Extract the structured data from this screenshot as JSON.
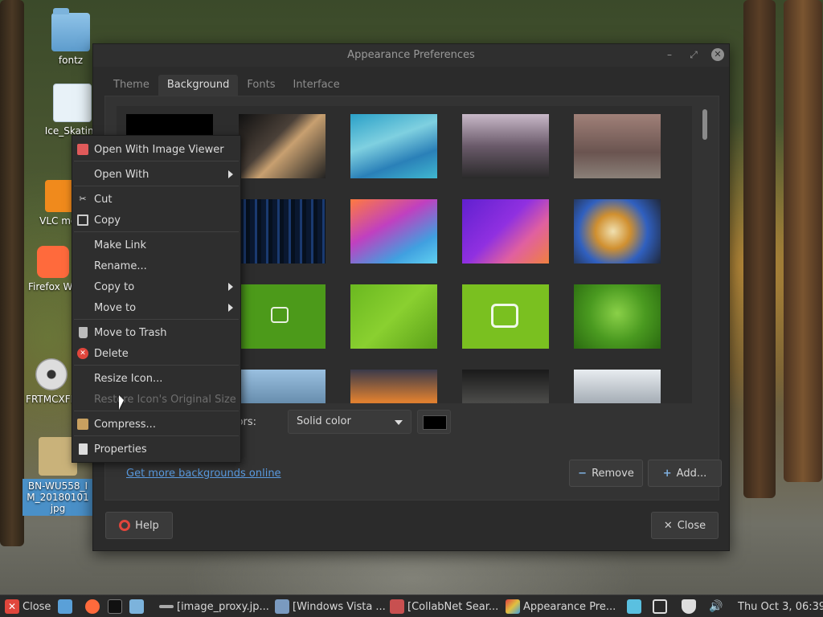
{
  "desktop": {
    "icons": [
      {
        "label": "fontz"
      },
      {
        "label": "Ice_Skating"
      },
      {
        "label": "VLC med"
      },
      {
        "label": "Firefox We"
      },
      {
        "label": "FRTMCXFR"
      },
      {
        "label": "BN-WU558_I M_20180101 jpg"
      }
    ]
  },
  "window": {
    "title": "Appearance Preferences",
    "controls": {
      "minimize": "–",
      "maximize": "⤢",
      "close": "✕"
    },
    "tabs": [
      {
        "label": "Theme"
      },
      {
        "label": "Background"
      },
      {
        "label": "Fonts"
      },
      {
        "label": "Interface"
      }
    ],
    "active_tab": "Background",
    "colors_label": "olors:",
    "color_mode": "Solid color",
    "color_value": "#000000",
    "online_link": "Get more backgrounds online",
    "remove_label": "Remove",
    "add_label": "Add...",
    "help_label": "Help",
    "close_label": "Close"
  },
  "context_menu": {
    "items": [
      {
        "label": "Open With Image Viewer",
        "icon": "image-viewer-icon"
      },
      {
        "label": "Open With",
        "submenu": true
      },
      {
        "label": "Cut",
        "icon": "scissors-icon"
      },
      {
        "label": "Copy",
        "icon": "copy-icon"
      },
      {
        "label": "Make Link"
      },
      {
        "label": "Rename..."
      },
      {
        "label": "Copy to",
        "submenu": true
      },
      {
        "label": "Move to",
        "submenu": true
      },
      {
        "label": "Move to Trash",
        "icon": "trash-icon"
      },
      {
        "label": "Delete",
        "icon": "delete-icon"
      },
      {
        "label": "Resize Icon..."
      },
      {
        "label": "Restore Icon's Original Size",
        "disabled": true
      },
      {
        "label": "Compress...",
        "icon": "archive-icon"
      },
      {
        "label": "Properties",
        "icon": "properties-icon"
      }
    ]
  },
  "taskbar": {
    "close_label": "Close",
    "tasks": [
      {
        "label": "[image_proxy.jp..."
      },
      {
        "label": "[Windows Vista ..."
      },
      {
        "label": "[CollabNet Sear..."
      },
      {
        "label": "Appearance Pre..."
      }
    ],
    "clock": "Thu Oct  3, 06:39"
  },
  "colors": {
    "accent": "#5a9be0",
    "window_bg": "#2b2b2b",
    "menu_bg": "#2e2e2e",
    "delete_red": "#e0463c",
    "close_red": "#e0463c"
  }
}
